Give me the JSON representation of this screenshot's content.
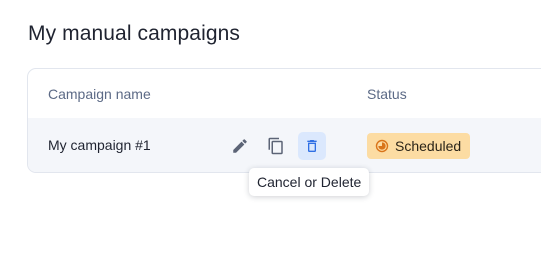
{
  "page": {
    "title": "My manual campaigns"
  },
  "table": {
    "columns": {
      "campaign_name": "Campaign name",
      "status": "Status"
    },
    "rows": [
      {
        "name": "My campaign #1",
        "actions": [
          "pencil-icon",
          "copy-icon",
          "trash-icon"
        ],
        "status": "Scheduled"
      }
    ]
  },
  "tooltip": {
    "text": "Cancel or Delete"
  },
  "colors": {
    "action_icon": "#5c6476",
    "delete_accent": "#2f6fe4",
    "delete_bg": "#dbe8fd",
    "status_bg": "#fcdca3",
    "status_icon": "#d9741a",
    "row_bg": "#f4f6fa"
  }
}
